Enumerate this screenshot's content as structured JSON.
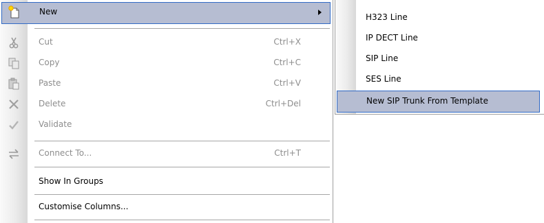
{
  "context_menu": {
    "items": [
      {
        "label": "New",
        "icon": "new-document-icon",
        "submenu": true,
        "highlighted": true
      },
      {
        "label": "Cut",
        "shortcut": "Ctrl+X",
        "icon": "scissors-icon",
        "enabled": false
      },
      {
        "label": "Copy",
        "shortcut": "Ctrl+C",
        "icon": "copy-icon",
        "enabled": false
      },
      {
        "label": "Paste",
        "shortcut": "Ctrl+V",
        "icon": "paste-icon",
        "enabled": false
      },
      {
        "label": "Delete",
        "shortcut": "Ctrl+Del",
        "icon": "delete-x-icon",
        "enabled": false
      },
      {
        "label": "Validate",
        "icon": "checkmark-icon",
        "enabled": false
      },
      {
        "label": "Connect To...",
        "shortcut": "Ctrl+T",
        "icon": "connect-arrows-icon",
        "enabled": false
      },
      {
        "label": "Show In Groups"
      },
      {
        "label": "Customise Columns..."
      }
    ]
  },
  "submenu": {
    "items": [
      {
        "label": "H323 Line"
      },
      {
        "label": "IP DECT Line"
      },
      {
        "label": "SIP Line"
      },
      {
        "label": "SES Line"
      },
      {
        "label": "New SIP Trunk From Template",
        "highlighted": true
      }
    ]
  },
  "colors": {
    "highlight_fill": "#b6bdd2",
    "highlight_border": "#316ac5",
    "disabled_text": "#8d8d8d"
  }
}
